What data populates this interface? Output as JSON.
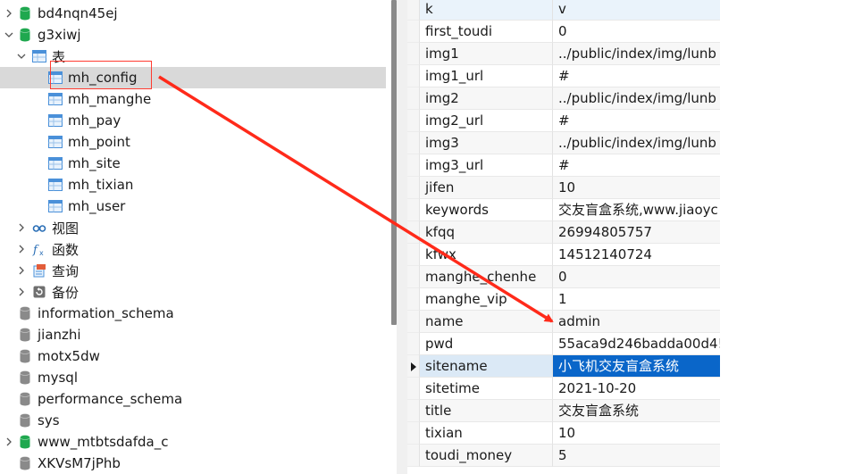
{
  "tree": {
    "databases_top": [
      {
        "label": "bd4nqn45ej",
        "expanded": false,
        "color": "#1fa84f"
      },
      {
        "label": "g3xiwj",
        "expanded": true,
        "color": "#1fa84f"
      }
    ],
    "tables_group": {
      "label": "表"
    },
    "tables": [
      {
        "label": "mh_config",
        "selected": true
      },
      {
        "label": "mh_manghe"
      },
      {
        "label": "mh_pay"
      },
      {
        "label": "mh_point"
      },
      {
        "label": "mh_site"
      },
      {
        "label": "mh_tixian"
      },
      {
        "label": "mh_user"
      }
    ],
    "groups": [
      {
        "label": "视图",
        "icon": "view-icon"
      },
      {
        "label": "函数",
        "icon": "function-icon"
      },
      {
        "label": "查询",
        "icon": "query-icon"
      },
      {
        "label": "备份",
        "icon": "backup-icon"
      }
    ],
    "databases_bottom": [
      {
        "label": "information_schema",
        "color": "#8a8a8a"
      },
      {
        "label": "jianzhi",
        "color": "#8a8a8a"
      },
      {
        "label": "motx5dw",
        "color": "#8a8a8a"
      },
      {
        "label": "mysql",
        "color": "#8a8a8a"
      },
      {
        "label": "performance_schema",
        "color": "#8a8a8a"
      },
      {
        "label": "sys",
        "color": "#8a8a8a"
      },
      {
        "label": "www_mtbtsdafda_c",
        "color": "#1fa84f"
      },
      {
        "label": "XKVsM7jPhb",
        "color": "#8a8a8a"
      }
    ]
  },
  "grid": {
    "columns": [
      "k",
      "v"
    ],
    "rows": [
      {
        "k": "first_toudi",
        "v": "0"
      },
      {
        "k": "img1",
        "v": "../public/index/img/lunb"
      },
      {
        "k": "img1_url",
        "v": "#"
      },
      {
        "k": "img2",
        "v": "../public/index/img/lunb"
      },
      {
        "k": "img2_url",
        "v": "#"
      },
      {
        "k": "img3",
        "v": "../public/index/img/lunb"
      },
      {
        "k": "img3_url",
        "v": "#"
      },
      {
        "k": "jifen",
        "v": "10"
      },
      {
        "k": "keywords",
        "v": "交友盲盒系统,www.jiaoyc"
      },
      {
        "k": "kfqq",
        "v": "26994805757"
      },
      {
        "k": "kfwx",
        "v": "14512140724"
      },
      {
        "k": "manghe_chenhe",
        "v": "0"
      },
      {
        "k": "manghe_vip",
        "v": "1"
      },
      {
        "k": "name",
        "v": "admin"
      },
      {
        "k": "pwd",
        "v": "55aca9d246badda00d4!"
      },
      {
        "k": "sitename",
        "v": "小飞机交友盲盒系统",
        "selected": true
      },
      {
        "k": "sitetime",
        "v": "2021-10-20"
      },
      {
        "k": "title",
        "v": "交友盲盒系统"
      },
      {
        "k": "tixian",
        "v": "10"
      },
      {
        "k": "toudi_money",
        "v": "5"
      }
    ]
  },
  "colors": {
    "annotation": "#ff2a1a",
    "selection": "#0a66c9"
  }
}
